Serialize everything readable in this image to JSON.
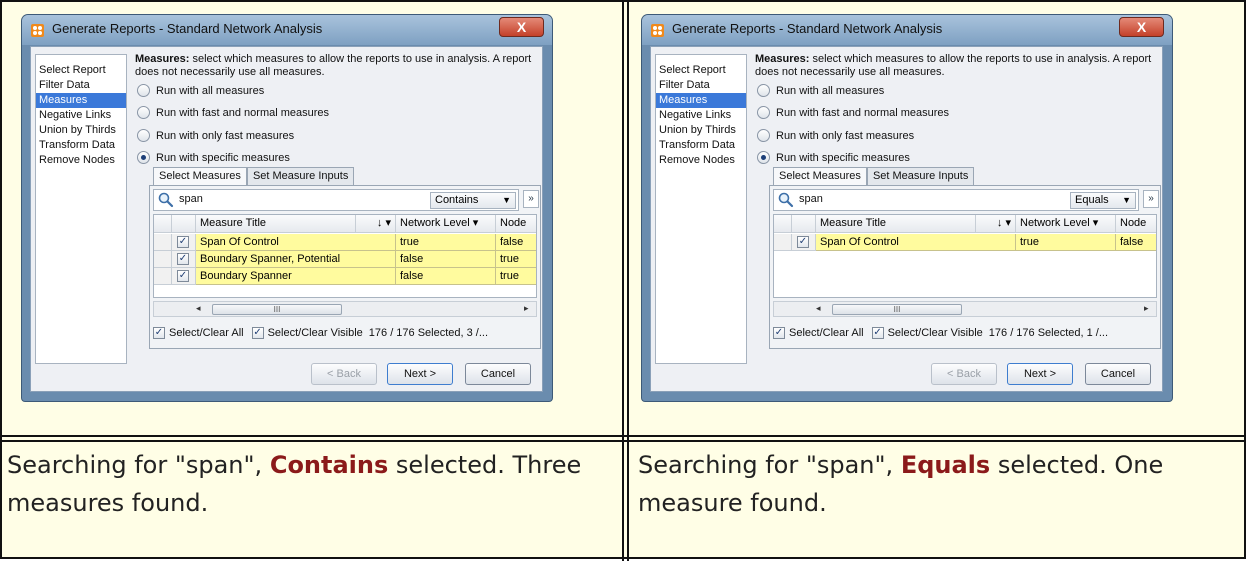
{
  "panels": [
    {
      "dialog": {
        "title": "Generate Reports - Standard Network Analysis",
        "close_label": "X",
        "nav_items": [
          "Select Report",
          "Filter Data",
          "Measures",
          "Negative Links",
          "Union by Thirds",
          "Transform Data",
          "Remove Nodes"
        ],
        "selected_nav": "Measures",
        "desc_bold": "Measures:",
        "desc_text": " select which measures to allow the reports to use in analysis. A report does not necessarily use all measures.",
        "radios": [
          "Run with all measures",
          "Run with fast and normal measures",
          "Run with only fast measures",
          "Run with specific measures"
        ],
        "selected_radio": "Run with specific measures",
        "tabs": [
          "Select Measures",
          "Set Measure Inputs"
        ],
        "search_value": "span",
        "match_mode": "Contains",
        "expand_glyph": "»",
        "columns": [
          "Measure Title",
          "↓ ▾",
          "Network Level ▾",
          "Node"
        ],
        "rows": [
          {
            "checked": true,
            "title": "Span Of Control",
            "network_level": "true",
            "node": "false"
          },
          {
            "checked": true,
            "title": "Boundary Spanner, Potential",
            "network_level": "false",
            "node": "true"
          },
          {
            "checked": true,
            "title": "Boundary Spanner",
            "network_level": "false",
            "node": "true"
          }
        ],
        "scroll_left": "◂",
        "scroll_right": "▸",
        "scroll_thumb": "III",
        "select_all": "Select/Clear All",
        "select_visible": "Select/Clear Visible",
        "count_text": "176 / 176 Selected, 3 /...",
        "back": "< Back",
        "next": "Next >",
        "cancel": "Cancel"
      },
      "caption_pre": "Searching for \"span\", ",
      "caption_bold": "Contains",
      "caption_post": " selected. Three measures found."
    },
    {
      "dialog": {
        "title": "Generate Reports - Standard Network Analysis",
        "close_label": "X",
        "nav_items": [
          "Select Report",
          "Filter Data",
          "Measures",
          "Negative Links",
          "Union by Thirds",
          "Transform Data",
          "Remove Nodes"
        ],
        "selected_nav": "Measures",
        "desc_bold": "Measures:",
        "desc_text": " select which measures to allow the reports to use in analysis. A report does not necessarily use all measures.",
        "radios": [
          "Run with all measures",
          "Run with fast and normal measures",
          "Run with only fast measures",
          "Run with specific measures"
        ],
        "selected_radio": "Run with specific measures",
        "tabs": [
          "Select Measures",
          "Set Measure Inputs"
        ],
        "search_value": "span",
        "match_mode": "Equals",
        "expand_glyph": "»",
        "columns": [
          "Measure Title",
          "↓ ▾",
          "Network Level ▾",
          "Node"
        ],
        "rows": [
          {
            "checked": true,
            "title": "Span Of Control",
            "network_level": "true",
            "node": "false"
          }
        ],
        "scroll_left": "◂",
        "scroll_right": "▸",
        "scroll_thumb": "III",
        "select_all": "Select/Clear All",
        "select_visible": "Select/Clear Visible",
        "count_text": "176 / 176 Selected, 1 /...",
        "back": "< Back",
        "next": "Next >",
        "cancel": "Cancel"
      },
      "caption_pre": "Searching for \"span\", ",
      "caption_bold": "Equals",
      "caption_post": " selected. One measure found."
    }
  ],
  "colors": {
    "caption_accent": "#8b1a1a",
    "cell_background": "#fffee6",
    "row_highlight": "#fffb9e",
    "nav_selected": "#3b79d9"
  }
}
